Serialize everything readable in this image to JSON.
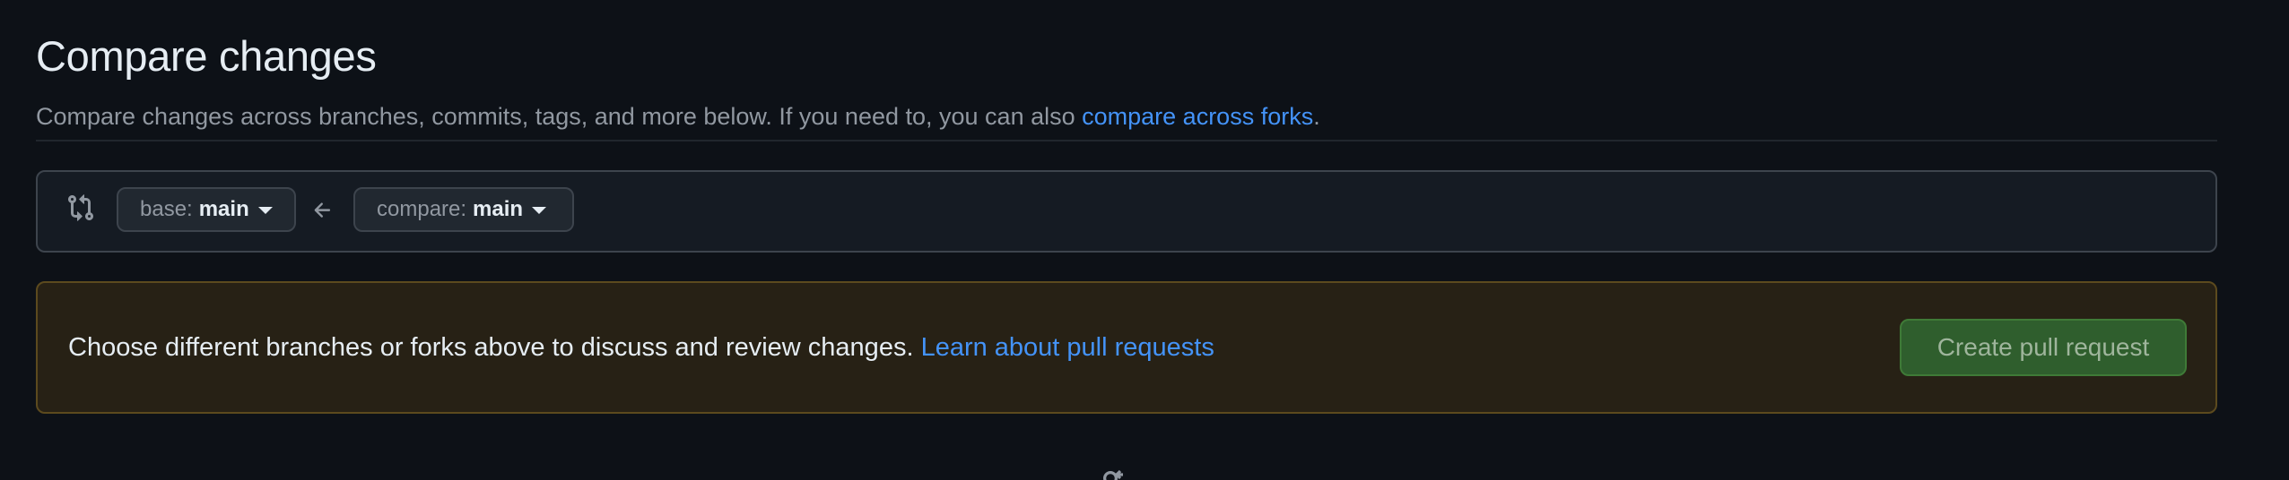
{
  "header": {
    "title": "Compare changes",
    "subtitle_text": "Compare changes across branches, commits, tags, and more below. If you need to, you can also ",
    "subtitle_link": "compare across forks",
    "subtitle_end": "."
  },
  "range": {
    "icon": "git-compare-icon",
    "base_prefix": "base:",
    "base_branch": "main",
    "arrow_icon": "arrow-left-icon",
    "compare_prefix": "compare:",
    "compare_branch": "main"
  },
  "flash": {
    "message": "Choose different branches or forks above to discuss and review changes.",
    "link": "Learn about pull requests",
    "create_button": "Create pull request"
  },
  "bottom": {
    "icon": "git-pull-request-icon"
  },
  "colors": {
    "background": "#0d1117",
    "link": "#4493f8",
    "flash_background": "#272115",
    "flash_border": "#5c4a1e",
    "create_button": "#2f5e2d"
  }
}
